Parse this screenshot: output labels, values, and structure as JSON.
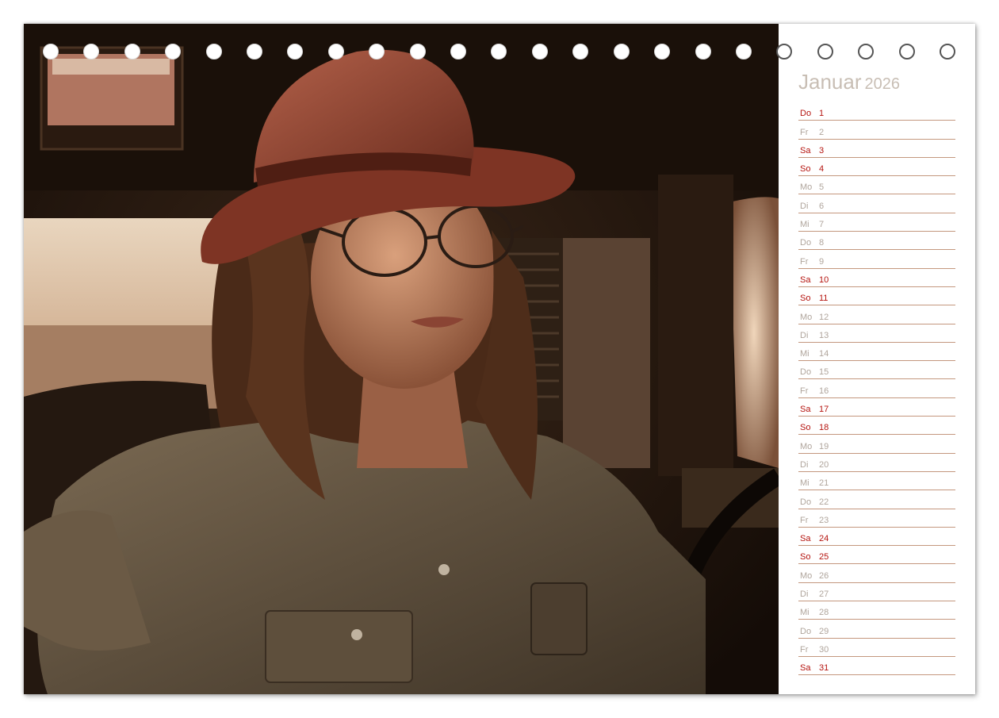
{
  "calendar": {
    "month": "Januar",
    "year": "2026",
    "days": [
      {
        "dn": "Do",
        "d": "1",
        "red": true
      },
      {
        "dn": "Fr",
        "d": "2",
        "red": false
      },
      {
        "dn": "Sa",
        "d": "3",
        "red": true
      },
      {
        "dn": "So",
        "d": "4",
        "red": true
      },
      {
        "dn": "Mo",
        "d": "5",
        "red": false
      },
      {
        "dn": "Di",
        "d": "6",
        "red": false
      },
      {
        "dn": "Mi",
        "d": "7",
        "red": false
      },
      {
        "dn": "Do",
        "d": "8",
        "red": false
      },
      {
        "dn": "Fr",
        "d": "9",
        "red": false
      },
      {
        "dn": "Sa",
        "d": "10",
        "red": true
      },
      {
        "dn": "So",
        "d": "11",
        "red": true
      },
      {
        "dn": "Mo",
        "d": "12",
        "red": false
      },
      {
        "dn": "Di",
        "d": "13",
        "red": false
      },
      {
        "dn": "Mi",
        "d": "14",
        "red": false
      },
      {
        "dn": "Do",
        "d": "15",
        "red": false
      },
      {
        "dn": "Fr",
        "d": "16",
        "red": false
      },
      {
        "dn": "Sa",
        "d": "17",
        "red": true
      },
      {
        "dn": "So",
        "d": "18",
        "red": true
      },
      {
        "dn": "Mo",
        "d": "19",
        "red": false
      },
      {
        "dn": "Di",
        "d": "20",
        "red": false
      },
      {
        "dn": "Mi",
        "d": "21",
        "red": false
      },
      {
        "dn": "Do",
        "d": "22",
        "red": false
      },
      {
        "dn": "Fr",
        "d": "23",
        "red": false
      },
      {
        "dn": "Sa",
        "d": "24",
        "red": true
      },
      {
        "dn": "So",
        "d": "25",
        "red": true
      },
      {
        "dn": "Mo",
        "d": "26",
        "red": false
      },
      {
        "dn": "Di",
        "d": "27",
        "red": false
      },
      {
        "dn": "Mi",
        "d": "28",
        "red": false
      },
      {
        "dn": "Do",
        "d": "29",
        "red": false
      },
      {
        "dn": "Fr",
        "d": "30",
        "red": false
      },
      {
        "dn": "Sa",
        "d": "31",
        "red": true
      }
    ]
  },
  "colors": {
    "weekend": "#b5140f",
    "weekday": "#b0a59c",
    "rule": "#c4977e",
    "title": "#c8beb4"
  }
}
